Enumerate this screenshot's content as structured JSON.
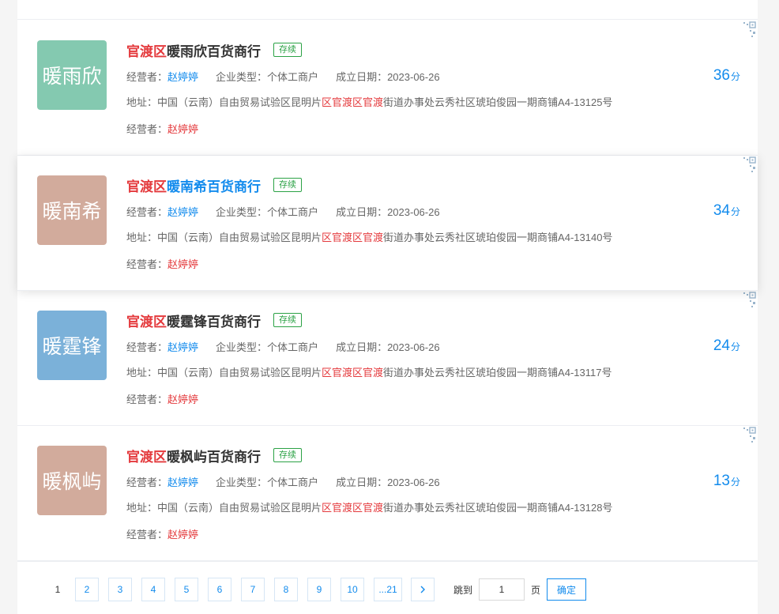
{
  "companies": [
    {
      "avatar_text": "暖雨欣",
      "avatar_color": "#84c9b0",
      "title_district": "官渡区",
      "title_name": "暖雨欣百货商行",
      "status": "存续",
      "operator_label": "经营者：",
      "operator": "赵婷婷",
      "type_label": "企业类型：",
      "type": "个体工商户",
      "date_label": "成立日期：",
      "date": "2023-06-26",
      "addr_label": "地址：",
      "addr_prefix": "中国（云南）自由贸易试验区昆明片",
      "addr_hl": "区官渡区官渡",
      "addr_suffix": "街道办事处云秀社区琥珀俊园一期商铺A4-13125号",
      "operator2_label": "经营者：",
      "operator2": "赵婷婷",
      "score": "36",
      "score_unit": "分"
    },
    {
      "avatar_text": "暖南希",
      "avatar_color": "#d2ab9c",
      "title_district": "官渡区",
      "title_name": "暖南希百货商行",
      "status": "存续",
      "operator_label": "经营者：",
      "operator": "赵婷婷",
      "type_label": "企业类型：",
      "type": "个体工商户",
      "date_label": "成立日期：",
      "date": "2023-06-26",
      "addr_label": "地址：",
      "addr_prefix": "中国（云南）自由贸易试验区昆明片",
      "addr_hl": "区官渡区官渡",
      "addr_suffix": "街道办事处云秀社区琥珀俊园一期商铺A4-13140号",
      "operator2_label": "经营者：",
      "operator2": "赵婷婷",
      "score": "34",
      "score_unit": "分"
    },
    {
      "avatar_text": "暖霆锋",
      "avatar_color": "#7bb1d9",
      "title_district": "官渡区",
      "title_name": "暖霆锋百货商行",
      "status": "存续",
      "operator_label": "经营者：",
      "operator": "赵婷婷",
      "type_label": "企业类型：",
      "type": "个体工商户",
      "date_label": "成立日期：",
      "date": "2023-06-26",
      "addr_label": "地址：",
      "addr_prefix": "中国（云南）自由贸易试验区昆明片",
      "addr_hl": "区官渡区官渡",
      "addr_suffix": "街道办事处云秀社区琥珀俊园一期商铺A4-13117号",
      "operator2_label": "经营者：",
      "operator2": "赵婷婷",
      "score": "24",
      "score_unit": "分"
    },
    {
      "avatar_text": "暖枫屿",
      "avatar_color": "#d2ab9c",
      "title_district": "官渡区",
      "title_name": "暖枫屿百货商行",
      "status": "存续",
      "operator_label": "经营者：",
      "operator": "赵婷婷",
      "type_label": "企业类型：",
      "type": "个体工商户",
      "date_label": "成立日期：",
      "date": "2023-06-26",
      "addr_label": "地址：",
      "addr_prefix": "中国（云南）自由贸易试验区昆明片",
      "addr_hl": "区官渡区官渡",
      "addr_suffix": "街道办事处云秀社区琥珀俊园一期商铺A4-13128号",
      "operator2_label": "经营者：",
      "operator2": "赵婷婷",
      "score": "13",
      "score_unit": "分"
    }
  ],
  "pagination": {
    "current": "1",
    "pages": [
      "2",
      "3",
      "4",
      "5",
      "6",
      "7",
      "8",
      "9",
      "10",
      "...21"
    ],
    "next_icon": "chevron-right-icon",
    "jump_label": "跳到",
    "jump_value": "1",
    "page_label": "页",
    "confirm_label": "确定"
  },
  "colors": {
    "accent_blue": "#128bed",
    "highlight_red": "#e4393c",
    "status_green": "#2ba245"
  }
}
